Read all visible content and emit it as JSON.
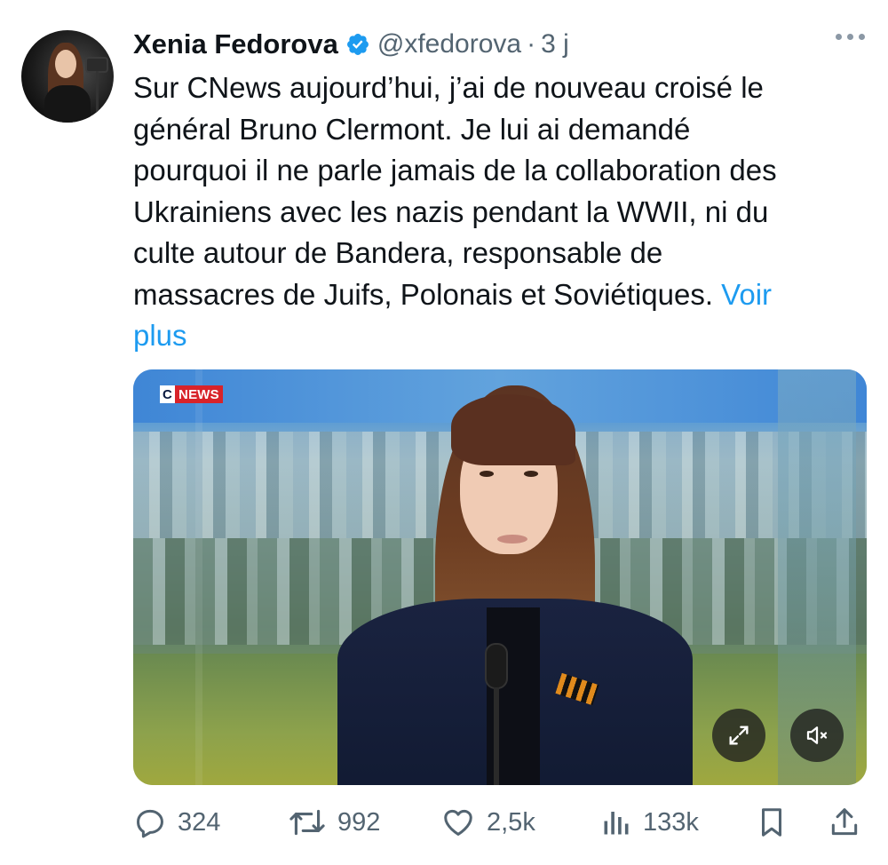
{
  "author": {
    "name": "Xenia Fedorova",
    "handle": "@xfedorova",
    "separator": "·",
    "time": "3 j",
    "verified": true,
    "avatar_icon": "avatar"
  },
  "tweet": {
    "lines": [
      "Sur CNews aujourd’hui, j’ai de nouveau croisé le",
      "général Bruno Clermont. Je lui ai demandé",
      "pourquoi il ne parle jamais de la collaboration des",
      "Ukrainiens avec les nazis pendant la WWII, ni du",
      "culte autour de Bandera, responsable de"
    ],
    "last_line": "massacres de Juifs, Polonais et Soviétiques.",
    "more_part1": "Voir",
    "more_part2": "plus"
  },
  "media": {
    "logo_c": "C",
    "logo_news": "NEWS",
    "expand_icon": "expand-icon",
    "mute_icon": "mute-icon"
  },
  "actions": {
    "replies": "324",
    "retweets": "992",
    "likes": "2,5k",
    "views": "133k"
  },
  "colors": {
    "accent": "#1d9bf0",
    "muted": "#536471",
    "text": "#0f1419",
    "cnews_red": "#d8232a"
  }
}
